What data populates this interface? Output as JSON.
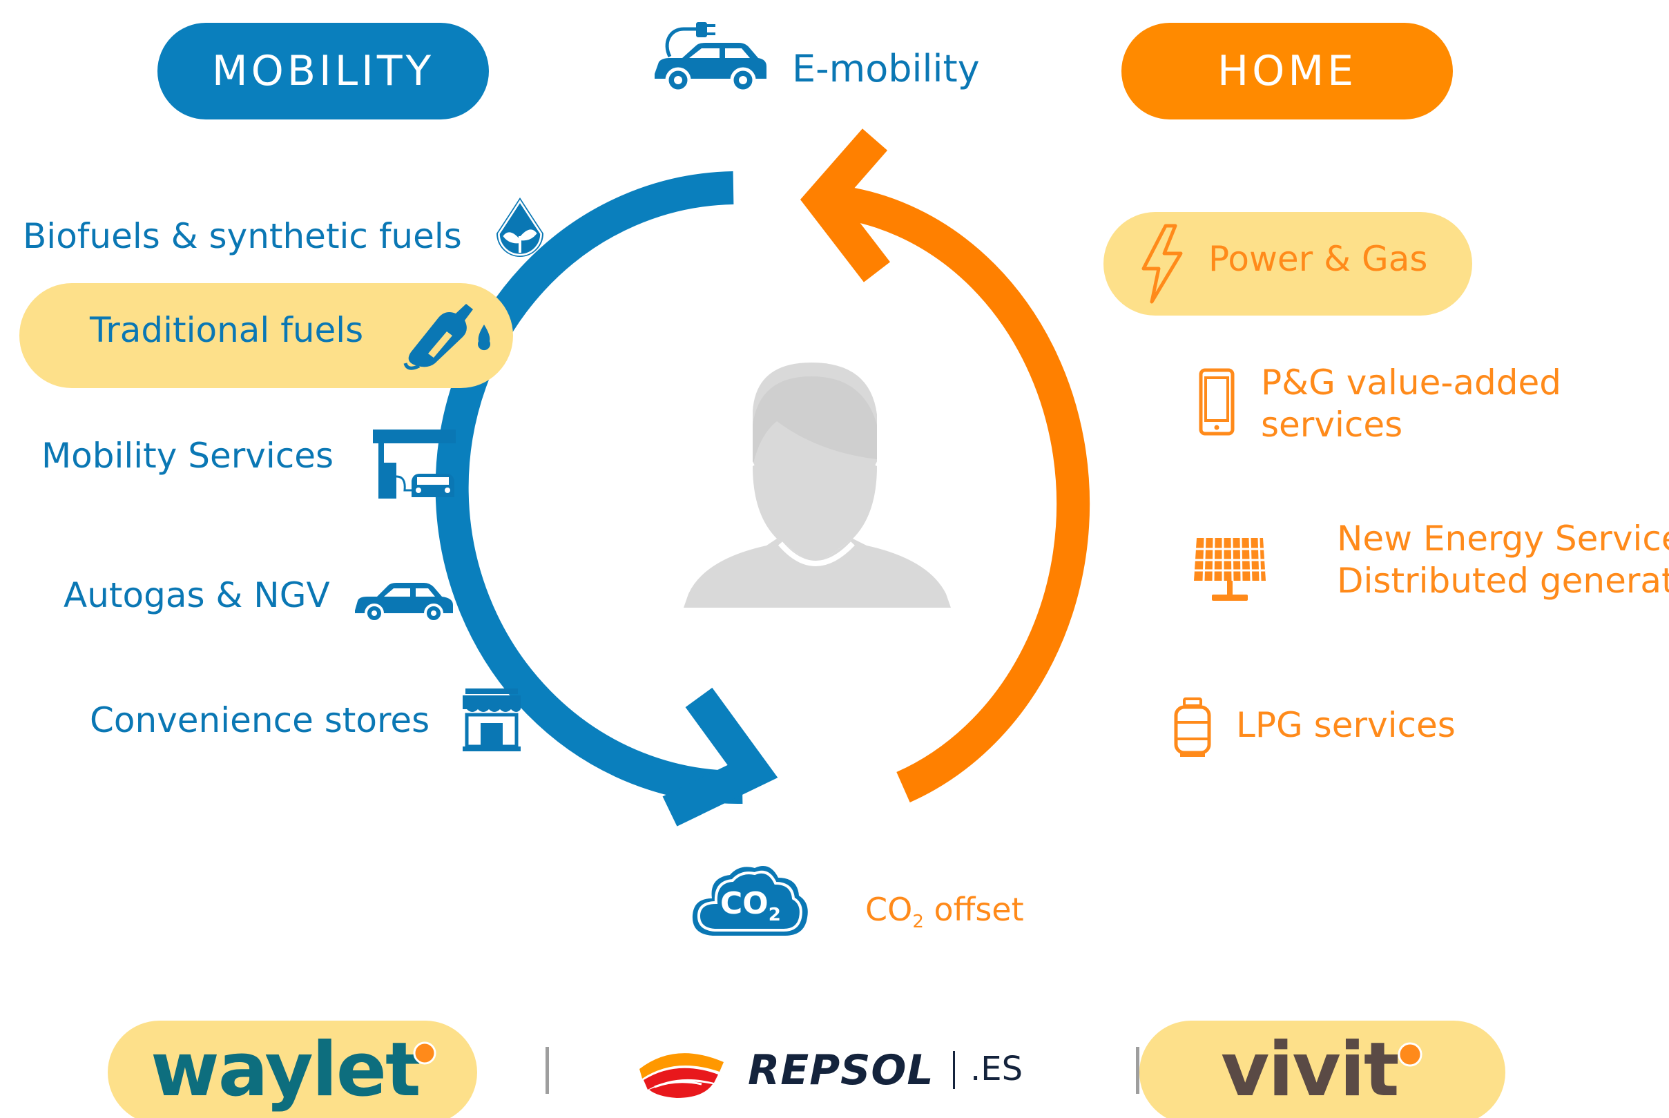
{
  "header": {
    "mobility_label": "MOBILITY",
    "emobility_label": "E-mobility",
    "home_label": "HOME"
  },
  "mobility": {
    "biofuels_label": "Biofuels & synthetic fuels",
    "traditional_label": "Traditional fuels",
    "services_label": "Mobility Services",
    "autogas_label": "Autogas & NGV",
    "stores_label": "Convenience stores"
  },
  "home": {
    "powergas_label": "Power & Gas",
    "pg_value_line1": "P&G value-added",
    "pg_value_line2": "services",
    "new_energy_line1": "New Energy Services –",
    "new_energy_line2": "Distributed generation",
    "lpg_label": "LPG services"
  },
  "co2": {
    "cloud_text": "CO",
    "cloud_sub": "2",
    "offset_prefix": "CO",
    "offset_sub": "2",
    "offset_suffix": " offset"
  },
  "brands": {
    "waylet": "waylet",
    "repsol": "REPSOL",
    "repsol_suffix": ".ES",
    "vivit": "vivit"
  },
  "colors": {
    "blue": "#0a77b4",
    "orange": "#ff8a1a",
    "highlight": "#fde08a",
    "person": "#d9d9d9"
  }
}
